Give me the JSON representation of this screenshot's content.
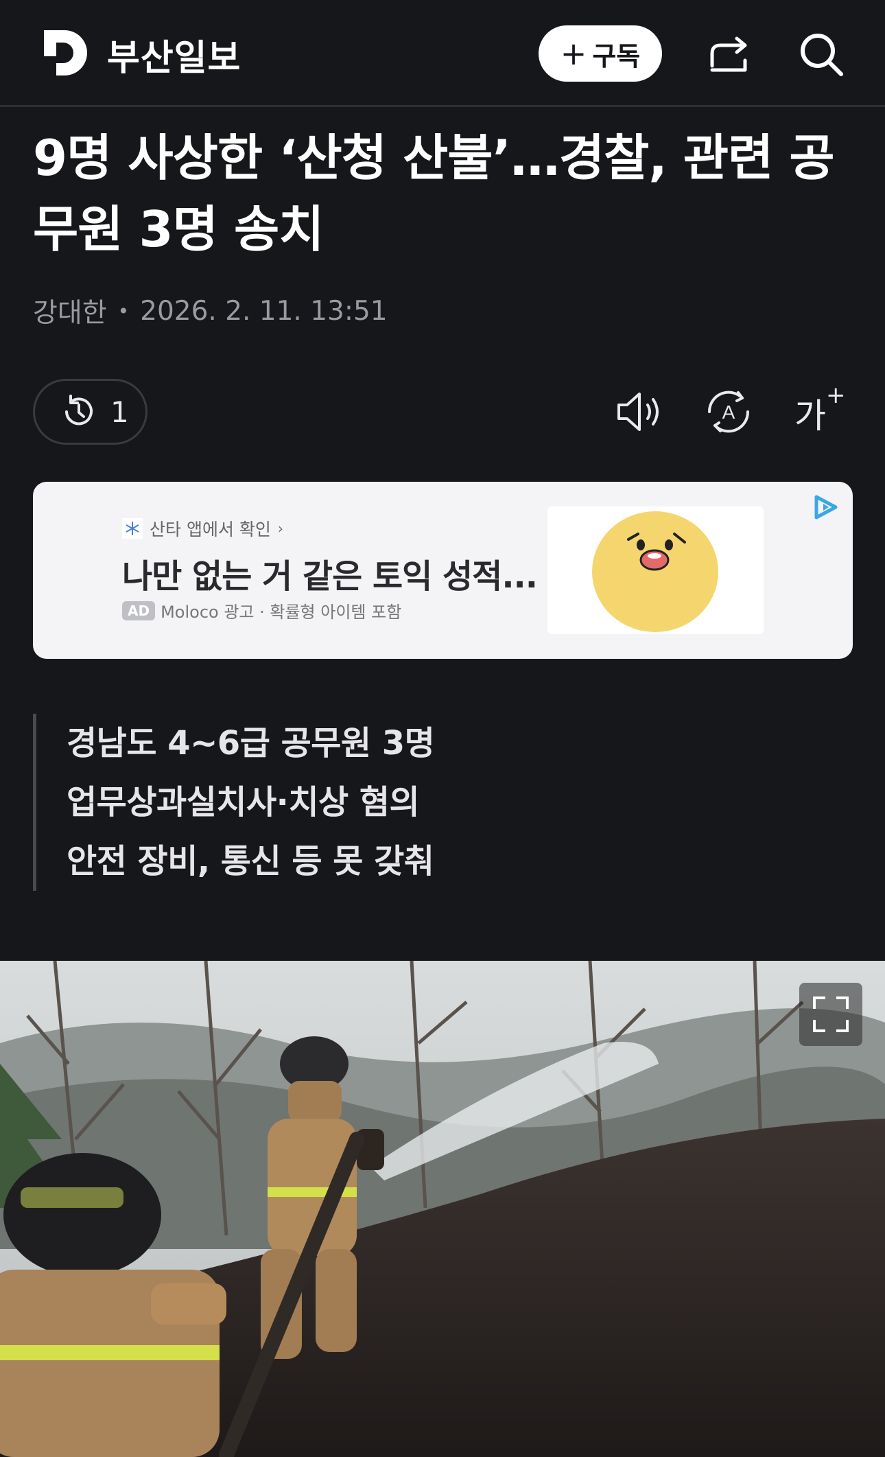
{
  "header": {
    "brand": "부산일보",
    "subscribe_label": "구독",
    "colors": {
      "background": "#16171b",
      "accent": "#ffffff"
    }
  },
  "article": {
    "headline": "9명 사상한 ‘산청 산불’…경찰, 관련 공무원 3명 송치",
    "author": "강대한",
    "timestamp": "2026. 2. 11. 13:51",
    "history_count": "1",
    "summary": [
      "경남도 4~6급 공무원 3명",
      "업무상과실치사·치상 혐의",
      "안전 장비, 통신 등 못 갖춰"
    ]
  },
  "toolbar": {
    "icons": [
      "history-icon",
      "speaker-icon",
      "translate-icon",
      "font-size-icon"
    ],
    "font_size_label": "가"
  },
  "ad": {
    "source": "산타 앱에서 확인",
    "title": "나만 없는 거 같은 토익 성적...",
    "badge": "AD",
    "meta": "Moloco 광고 · 확률형 아이템 포함"
  },
  "photo": {
    "icons": [
      "expand-icon"
    ]
  }
}
